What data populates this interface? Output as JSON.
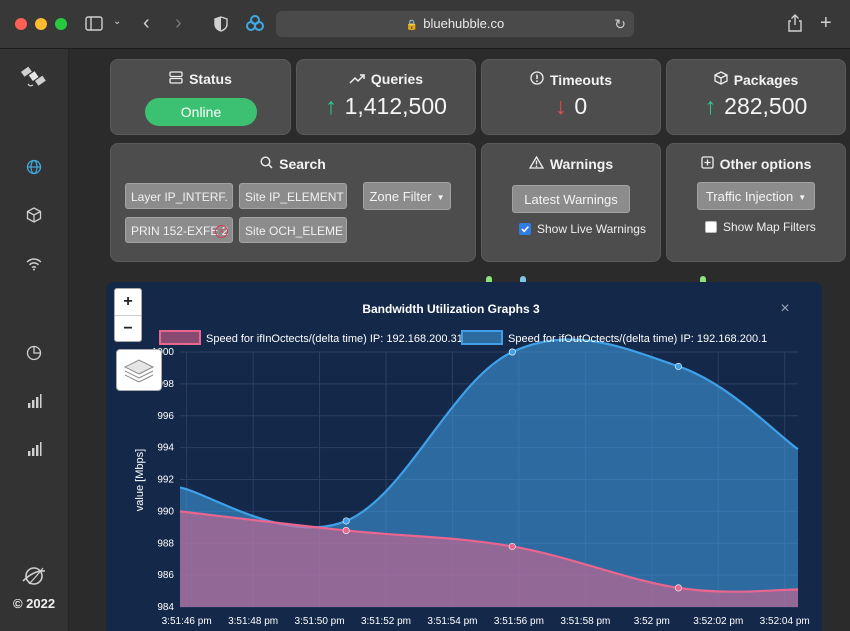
{
  "browser": {
    "url": "bluehubble.co"
  },
  "sidebar": {
    "copyright": "© 2022",
    "icons": [
      "satellite-icon",
      "globe-icon",
      "cube-icon",
      "wifi-icon",
      "pie-chart-icon",
      "bar-chart-icon",
      "bar-chart-icon"
    ]
  },
  "cards": {
    "status": {
      "title": "Status",
      "value": "Online"
    },
    "queries": {
      "title": "Queries",
      "value": "1,412,500"
    },
    "timeouts": {
      "title": "Timeouts",
      "value": "0"
    },
    "packages": {
      "title": "Packages",
      "value": "282,500"
    },
    "search": {
      "title": "Search",
      "chips": [
        "Layer IP_INTERF.",
        "Site IP_ELEMENT",
        "PRIN 152-EXFE 2",
        "Site OCH_ELEME"
      ],
      "zone_filter": "Zone Filter"
    },
    "warnings": {
      "title": "Warnings",
      "button": "Latest Warnings",
      "checkbox_label": "Show Live Warnings",
      "checked": true
    },
    "other": {
      "title": "Other options",
      "button": "Traffic Injection",
      "checkbox_label": "Show Map Filters",
      "checked": false
    }
  },
  "map_controls": {
    "zoom_in": "+",
    "zoom_out": "−"
  },
  "colors": {
    "accent_green": "#3cc172",
    "up": "#2ecc8a",
    "down": "#e84c4c",
    "series_in": "#e8668f",
    "series_out": "#3fa0e8"
  },
  "chart_data": {
    "type": "area",
    "title": "Bandwidth Utilization Graphs 3",
    "close": "×",
    "ylabel": "value [Mbps]",
    "xlabel": "",
    "ylim": [
      984,
      1000
    ],
    "yticks": [
      984,
      986,
      988,
      990,
      992,
      994,
      996,
      998,
      1000
    ],
    "ytick_labels": [
      "984",
      "986",
      "988",
      "990",
      "992",
      "994",
      "996",
      "998",
      "1000"
    ],
    "x": [
      "3:51:46 pm",
      "3:51:48 pm",
      "3:51:50 pm",
      "3:51:52 pm",
      "3:51:54 pm",
      "3:51:56 pm",
      "3:51:58 pm",
      "3:52 pm",
      "3:52:02 pm",
      "3:52:04 pm"
    ],
    "x_range": [
      -0.1,
      9.2
    ],
    "series": [
      {
        "name": "Speed for ifInOctects/(delta time) IP: 192.168.200.31",
        "points": [
          [
            -0.1,
            990.0
          ],
          [
            2.4,
            988.8
          ],
          [
            4.9,
            987.8
          ],
          [
            7.4,
            985.2
          ],
          [
            9.2,
            985.1
          ]
        ]
      },
      {
        "name": "Speed for ifOutOctects/(delta time) IP: 192.168.200.1",
        "points": [
          [
            -0.1,
            991.5
          ],
          [
            2.4,
            989.4
          ],
          [
            4.9,
            1000.0
          ],
          [
            7.4,
            999.1
          ],
          [
            9.2,
            993.9
          ]
        ]
      }
    ],
    "grid": true,
    "legend": "top"
  }
}
